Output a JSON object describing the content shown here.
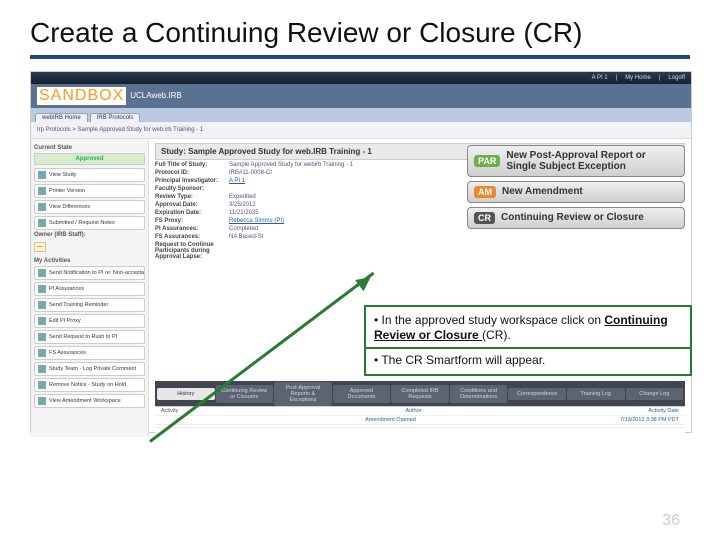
{
  "title": "Create a Continuing Review or Closure (CR)",
  "page_number": "36",
  "app": {
    "user": "A PI 1",
    "my_home": "My Home",
    "logoff": "Logoff",
    "sandbox": "SANDBOX",
    "product": "UCLAweb.IRB",
    "tabs": [
      "webIRB Home",
      "IRB Protocols"
    ],
    "breadcrumb": "Irp Protocols > Sample Approved Study for web.irb Training - 1"
  },
  "sidebar": {
    "current_state_label": "Current State",
    "state": "Approved",
    "btns": [
      "View Study",
      "Printer Version",
      "View Differences",
      "Submitted / Request Notes"
    ],
    "owner_label": "Owner (IRB Staff):",
    "owner": "—",
    "activities_label": "My Activities",
    "activities": [
      "Send Notification to PI re: Non-acceptance",
      "PI Assurances",
      "Send Training Reminder",
      "Edit PI Proxy",
      "Send Request to Rush to PI",
      "FS Assurances",
      "Study Team - Log Private Comment",
      "Remove Notice - Study on Hold",
      "View Amendment Workspace"
    ]
  },
  "study": {
    "title": "Study: Sample Approved Study for web.IRB Training - 1",
    "fields": [
      {
        "k": "Full Title of Study:",
        "v": "Sample Approved Study for webirb Training - 1"
      },
      {
        "k": "Protocol ID:",
        "v": "IRB#11-0008-CI"
      },
      {
        "k": "Principal Investigator:",
        "v": "A PI 1"
      },
      {
        "k": "Faculty Sponsor:",
        "v": ""
      },
      {
        "k": "Review Type:",
        "v": "Expedited"
      },
      {
        "k": "Approval Date:",
        "v": "3/25/2012"
      },
      {
        "k": "Expiration Date:",
        "v": "11/21/2035"
      },
      {
        "k": "FS Proxy:",
        "v": "Rebecca Simms (PI)"
      },
      {
        "k": "PI Assurances:",
        "v": "Completed"
      },
      {
        "k": "FS Assurances:",
        "v": "NA Based-St"
      },
      {
        "k": "Request to Continue Participants during Approval Lapse:",
        "v": ""
      }
    ]
  },
  "actions": [
    {
      "badge": "PAR",
      "label": "New Post-Approval Report or Single Subject Exception"
    },
    {
      "badge": "AM",
      "label": "New Amendment"
    },
    {
      "badge": "CR",
      "label": "Continuing Review or Closure"
    }
  ],
  "lower_tabs": [
    "History",
    "Continuing Review or Closures",
    "Post-Approval Reports & Exceptions",
    "Approved Documents",
    "Completed IRB Requests",
    "Conditions and Determinations",
    "Correspondence",
    "Training Log",
    "Change Log"
  ],
  "history": {
    "head": [
      "Activity",
      "Author",
      "Activity Date"
    ],
    "rows": [
      {
        "activity": "Amendment Opened",
        "author": "",
        "date": "7/13/2012 3:38 PM PDT"
      },
      {
        "activity": "",
        "author": "",
        "date": ""
      }
    ]
  },
  "callout": {
    "l1a": "In the approved study workspace click on ",
    "l1b": "Continuing Review or Closure ",
    "l1c": "(CR).",
    "l2": "• The CR Smartform will appear."
  }
}
